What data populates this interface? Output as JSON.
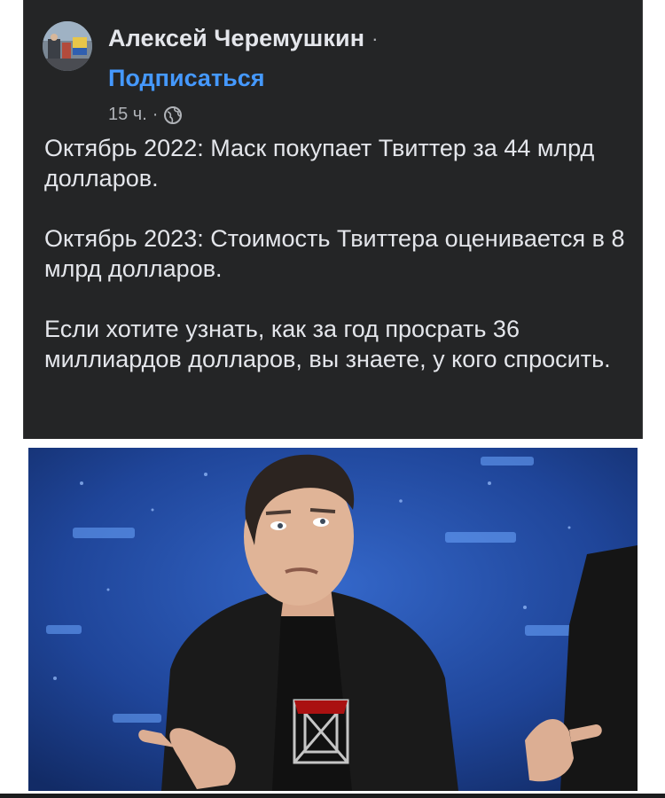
{
  "post": {
    "author": "Алексей Черемушкин",
    "author_separator": "·",
    "subscribe_label": "Подписаться",
    "time": "15 ч.",
    "meta_separator": "·",
    "privacy_icon": "globe-icon",
    "paragraphs": [
      "Октябрь 2022: Маск покупает Твиттер за 44 млрд долларов.",
      "Октябрь 2023: Стоимость Твиттера оценивается в 8 млрд долларов.",
      "Если хотите узнать, как за год просрать 36 миллиардов долларов, вы знаете, у кого спросить."
    ]
  },
  "colors": {
    "card_background": "#242526",
    "text_primary": "#e4e6eb",
    "text_secondary": "#b0b3b8",
    "link": "#4599ff",
    "photo_background": "#1d3f8c"
  }
}
